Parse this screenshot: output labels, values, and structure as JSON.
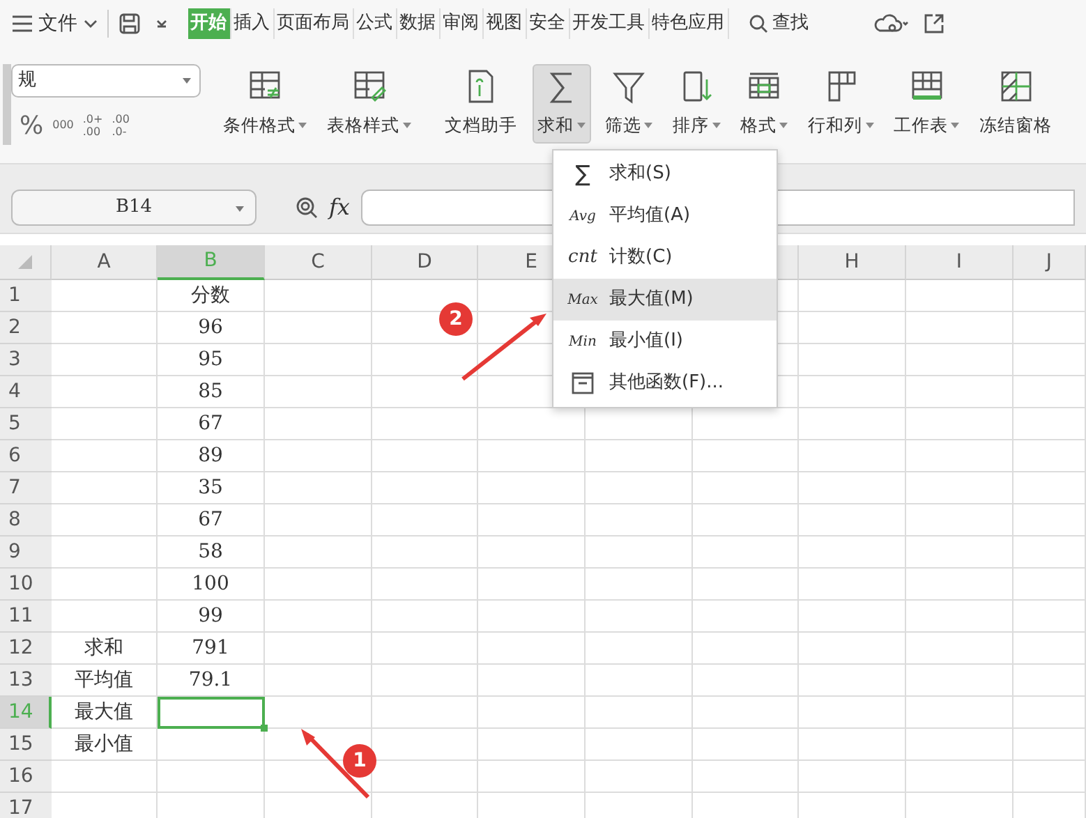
{
  "menubar": {
    "file_menu": "文件",
    "tabs": [
      {
        "label": "开始",
        "selected": true
      },
      {
        "label": "插入",
        "selected": false
      },
      {
        "label": "页面布局",
        "selected": false
      },
      {
        "label": "公式",
        "selected": false
      },
      {
        "label": "数据",
        "selected": false
      },
      {
        "label": "审阅",
        "selected": false
      },
      {
        "label": "视图",
        "selected": false
      },
      {
        "label": "安全",
        "selected": false
      },
      {
        "label": "开发工具",
        "selected": false
      },
      {
        "label": "特色应用",
        "selected": false
      }
    ],
    "search": "查找"
  },
  "ribbon": {
    "number_format": "规",
    "format_buttons": [
      "%",
      "000"
    ],
    "decimal_buttons": [
      {
        "top": ".0+",
        "bottom": ".00"
      },
      {
        "top": ".00",
        "bottom": ".0-"
      }
    ],
    "tools": [
      {
        "label": "条件格式",
        "dropdown": true,
        "pressed": false
      },
      {
        "label": "表格样式",
        "dropdown": true,
        "pressed": false
      },
      {
        "label": "文档助手",
        "dropdown": false,
        "pressed": false
      },
      {
        "label": "求和",
        "dropdown": true,
        "pressed": true
      },
      {
        "label": "筛选",
        "dropdown": true,
        "pressed": false
      },
      {
        "label": "排序",
        "dropdown": true,
        "pressed": false
      },
      {
        "label": "格式",
        "dropdown": true,
        "pressed": false
      },
      {
        "label": "行和列",
        "dropdown": true,
        "pressed": false
      },
      {
        "label": "工作表",
        "dropdown": true,
        "pressed": false
      },
      {
        "label": "冻结窗格",
        "dropdown": false,
        "pressed": false
      }
    ]
  },
  "formula_bar": {
    "name_box": "B14",
    "fx": "fx"
  },
  "sheet": {
    "columns_left": [
      {
        "label": "A",
        "selected": false
      },
      {
        "label": "B",
        "selected": true
      },
      {
        "label": "C",
        "selected": false
      },
      {
        "label": "D",
        "selected": false
      },
      {
        "label": "E",
        "selected": false
      }
    ],
    "columns_right": [
      {
        "label": "H",
        "selected": false
      },
      {
        "label": "I",
        "selected": false
      },
      {
        "label": "J",
        "selected": false
      }
    ],
    "rows": [
      {
        "number": "1",
        "selected": false,
        "cells": [
          "",
          "分数"
        ]
      },
      {
        "number": "2",
        "selected": false,
        "cells": [
          "",
          "96"
        ]
      },
      {
        "number": "3",
        "selected": false,
        "cells": [
          "",
          "95"
        ]
      },
      {
        "number": "4",
        "selected": false,
        "cells": [
          "",
          "85"
        ]
      },
      {
        "number": "5",
        "selected": false,
        "cells": [
          "",
          "67"
        ]
      },
      {
        "number": "6",
        "selected": false,
        "cells": [
          "",
          "89"
        ]
      },
      {
        "number": "7",
        "selected": false,
        "cells": [
          "",
          "35"
        ]
      },
      {
        "number": "8",
        "selected": false,
        "cells": [
          "",
          "67"
        ]
      },
      {
        "number": "9",
        "selected": false,
        "cells": [
          "",
          "58"
        ]
      },
      {
        "number": "10",
        "selected": false,
        "cells": [
          "",
          "100"
        ]
      },
      {
        "number": "11",
        "selected": false,
        "cells": [
          "",
          "99"
        ]
      },
      {
        "number": "12",
        "selected": false,
        "cells": [
          "求和",
          "791"
        ]
      },
      {
        "number": "13",
        "selected": false,
        "cells": [
          "平均值",
          "79.1"
        ]
      },
      {
        "number": "14",
        "selected": true,
        "cells": [
          "最大值",
          ""
        ]
      },
      {
        "number": "15",
        "selected": false,
        "cells": [
          "最小值",
          ""
        ]
      },
      {
        "number": "16",
        "selected": false,
        "cells": [
          "",
          ""
        ]
      },
      {
        "number": "17",
        "selected": false,
        "cells": [
          "",
          ""
        ]
      }
    ]
  },
  "sum_menu": {
    "items": [
      {
        "kind": "glyph",
        "icon_text": "∑",
        "label": "求和(S)",
        "selected": false
      },
      {
        "kind": "glyph",
        "icon_text": "Avg",
        "label": "平均值(A)",
        "selected": false
      },
      {
        "kind": "glyph",
        "icon_text": "cnt",
        "label": "计数(C)",
        "selected": false
      },
      {
        "kind": "glyph",
        "icon_text": "Max",
        "label": "最大值(M)",
        "selected": true
      },
      {
        "kind": "glyph",
        "icon_text": "Min",
        "label": "最小值(I)",
        "selected": false
      },
      {
        "kind": "icon",
        "label": "其他函数(F)...",
        "selected": false
      }
    ]
  },
  "annotations": [
    {
      "number": "2"
    },
    {
      "number": "1"
    }
  ]
}
